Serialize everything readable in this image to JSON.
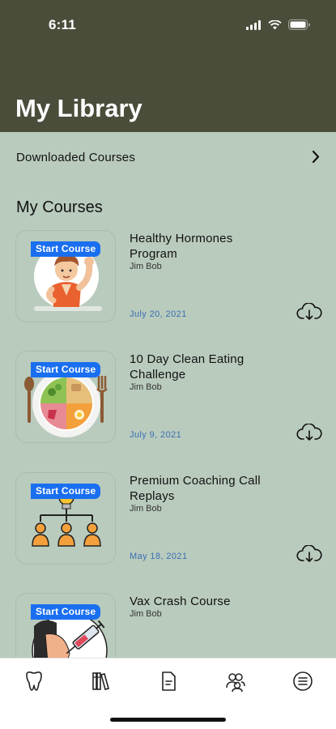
{
  "status": {
    "time": "6:11"
  },
  "header": {
    "title": "My Library"
  },
  "downloaded": {
    "label": "Downloaded Courses"
  },
  "section_title": "My Courses",
  "courses": [
    {
      "badge": "Start Course",
      "title": "Healthy Hormones Program",
      "author": "Jim Bob",
      "date": "July 20, 2021"
    },
    {
      "badge": "Start Course",
      "title": "10 Day Clean Eating Challenge",
      "author": "Jim Bob",
      "date": "July 9, 2021"
    },
    {
      "badge": "Start Course",
      "title": "Premium Coaching Call Replays",
      "author": "Jim Bob",
      "date": "May 18, 2021"
    },
    {
      "badge": "Start Course",
      "title": "Vax Crash Course",
      "author": "Jim Bob",
      "date": ""
    }
  ],
  "tabbar": {
    "items": [
      {
        "icon": "tooth-icon"
      },
      {
        "icon": "library-books-icon"
      },
      {
        "icon": "document-icon"
      },
      {
        "icon": "community-icon"
      },
      {
        "icon": "menu-list-icon"
      }
    ]
  },
  "colors": {
    "header_bg": "#4b4d3b",
    "page_bg": "#b9cbbd",
    "badge_bg": "#1a6ff0",
    "date_text": "#3b6fb3"
  }
}
